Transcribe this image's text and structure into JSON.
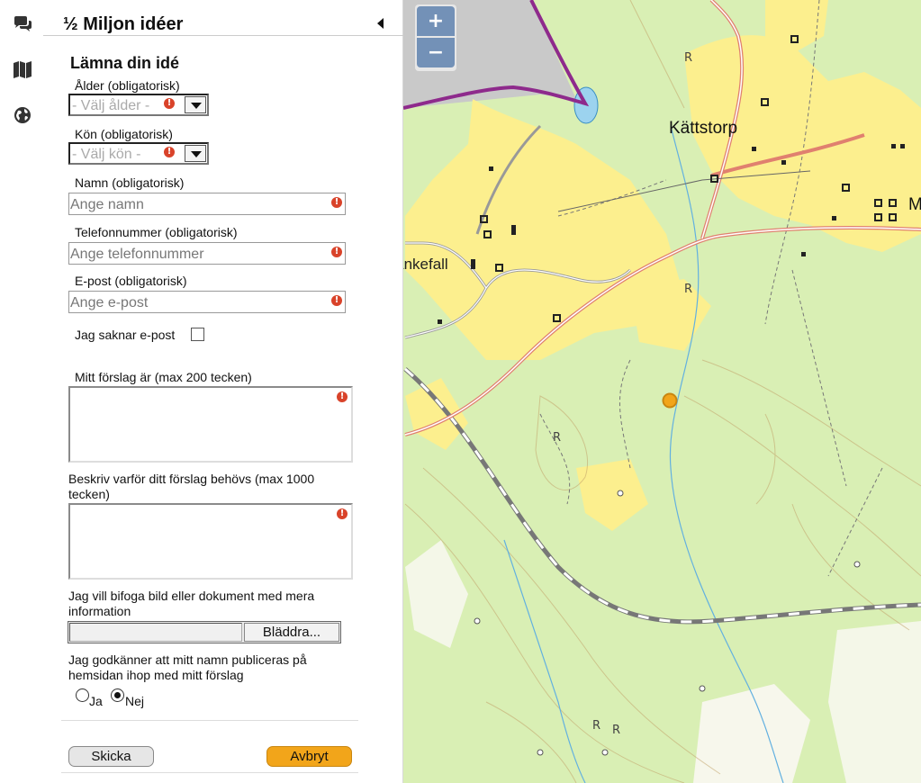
{
  "panel": {
    "title": "½ Miljon idéer"
  },
  "form": {
    "title": "Lämna din idé",
    "age": {
      "label": "Ålder (obligatorisk)",
      "placeholder": "- Välj ålder -"
    },
    "gender": {
      "label": "Kön (obligatorisk)",
      "placeholder": "- Välj kön -"
    },
    "name": {
      "label": "Namn (obligatorisk)",
      "placeholder": "Ange namn"
    },
    "phone": {
      "label": "Telefonnummer (obligatorisk)",
      "placeholder": "Ange telefonnummer"
    },
    "email": {
      "label": "E-post (obligatorisk)",
      "placeholder": "Ange e-post"
    },
    "no_email_label": "Jag saknar e-post",
    "no_email_checked": false,
    "proposal_label": "Mitt förslag är (max 200 tecken)",
    "proposal_value": "",
    "motivation_label": "Beskriv varför ditt förslag behövs (max 1000 tecken)",
    "motivation_value": "",
    "attach_label": "Jag vill bifoga bild eller dokument med mera information",
    "browse_label": "Bläddra...",
    "consent_label": "Jag godkänner att mitt namn publiceras på hemsidan ihop med mitt förslag",
    "consent_yes": "Ja",
    "consent_no": "Nej",
    "consent_selected": "Nej",
    "error_glyph": "!",
    "submit_label": "Skicka",
    "cancel_label": "Avbryt"
  },
  "map": {
    "zoom_in": "+",
    "zoom_out": "−",
    "places": [
      {
        "name": "Kättstorp"
      },
      {
        "name": "Blankefall"
      }
    ]
  },
  "icons": {
    "sidebar": [
      "chat-icon",
      "map-icon",
      "globe-icon"
    ]
  },
  "colors": {
    "cancel_button": "#f2a51a",
    "error_badge": "#d9432a",
    "boundary_line": "#8e2a8c",
    "road": "#e0806f",
    "field": "#fcef8e",
    "forest": "#d9efb4",
    "water": "#9cd3ef",
    "marker": "#f2a51a"
  }
}
